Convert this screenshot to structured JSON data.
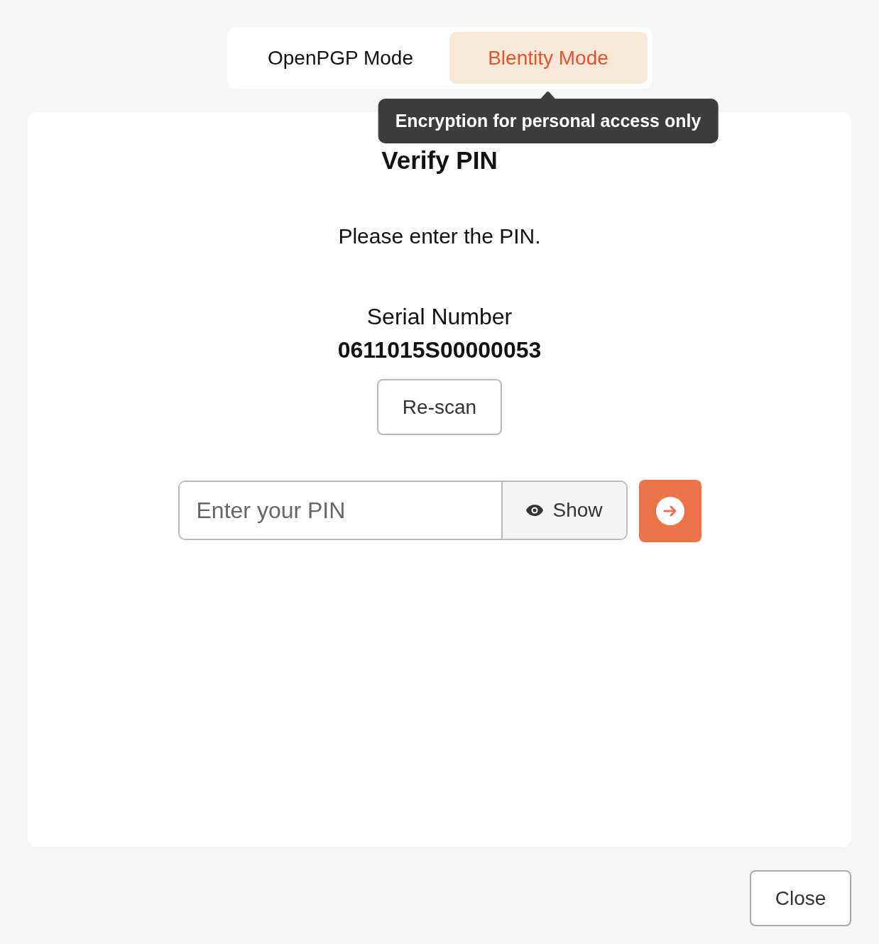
{
  "mode_tabs": [
    {
      "label": "OpenPGP Mode",
      "selected": false
    },
    {
      "label": "Blentity Mode",
      "selected": true
    }
  ],
  "tooltip": {
    "text": "Encryption for personal access only"
  },
  "card": {
    "title": "Verify PIN",
    "message": "Please enter the PIN.",
    "serial_label": "Serial Number",
    "serial_value": "0611015S00000053",
    "rescan_button": "Re-scan",
    "pin_field": {
      "placeholder": "Enter your PIN"
    },
    "show_button": "Show"
  },
  "close_button": "Close"
}
